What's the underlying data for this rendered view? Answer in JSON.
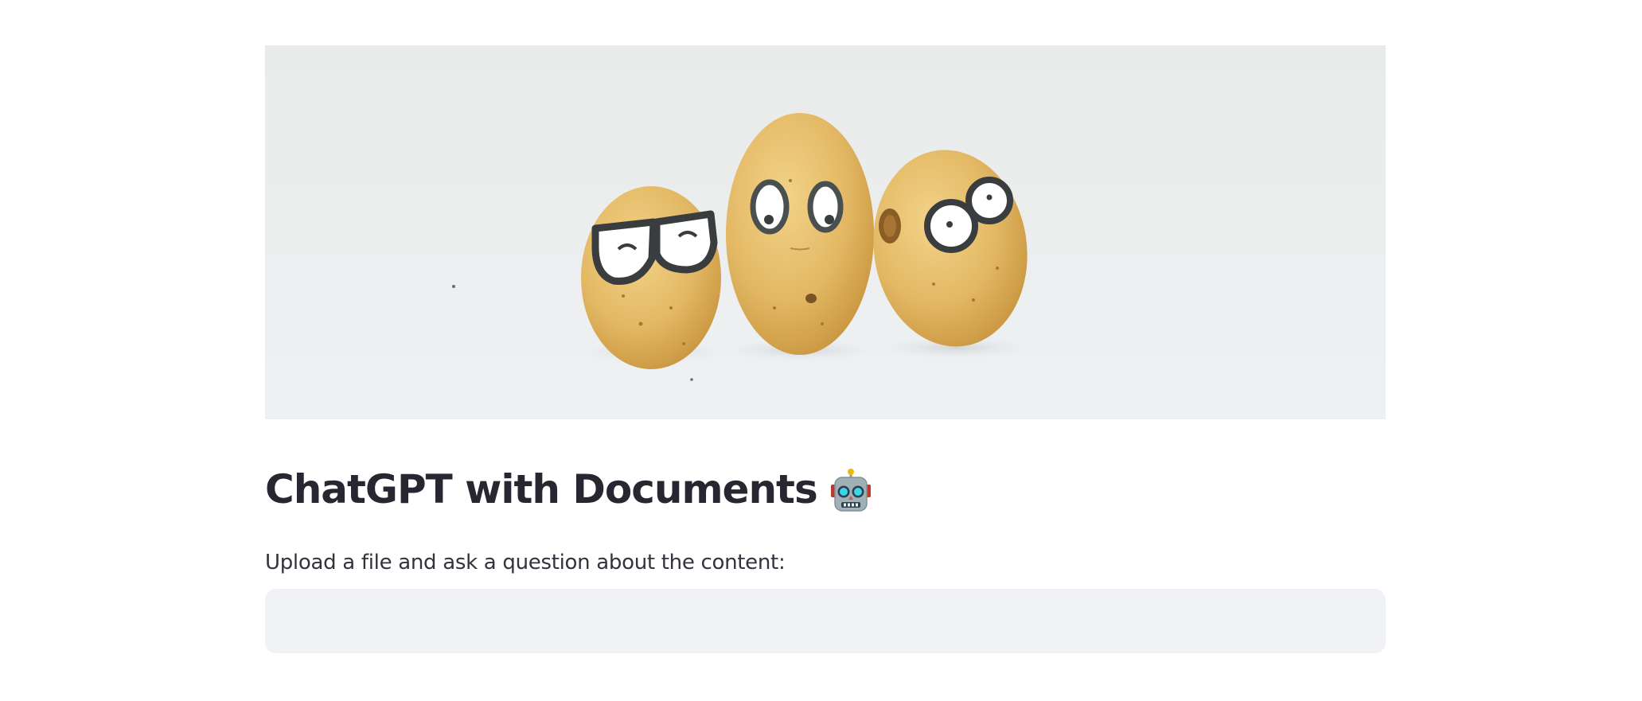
{
  "app": {
    "title": "ChatGPT with Documents",
    "title_emoji_icon": "robot-face-icon"
  },
  "hero_image": {
    "description_icon": "potatoes-with-glasses-illustration"
  },
  "question": {
    "label": "Upload a file and ask a question about the content:",
    "value": "",
    "placeholder": ""
  },
  "colors": {
    "background": "#ffffff",
    "text": "#262730",
    "input_background": "#f0f2f6",
    "potato": "#e3b864"
  }
}
